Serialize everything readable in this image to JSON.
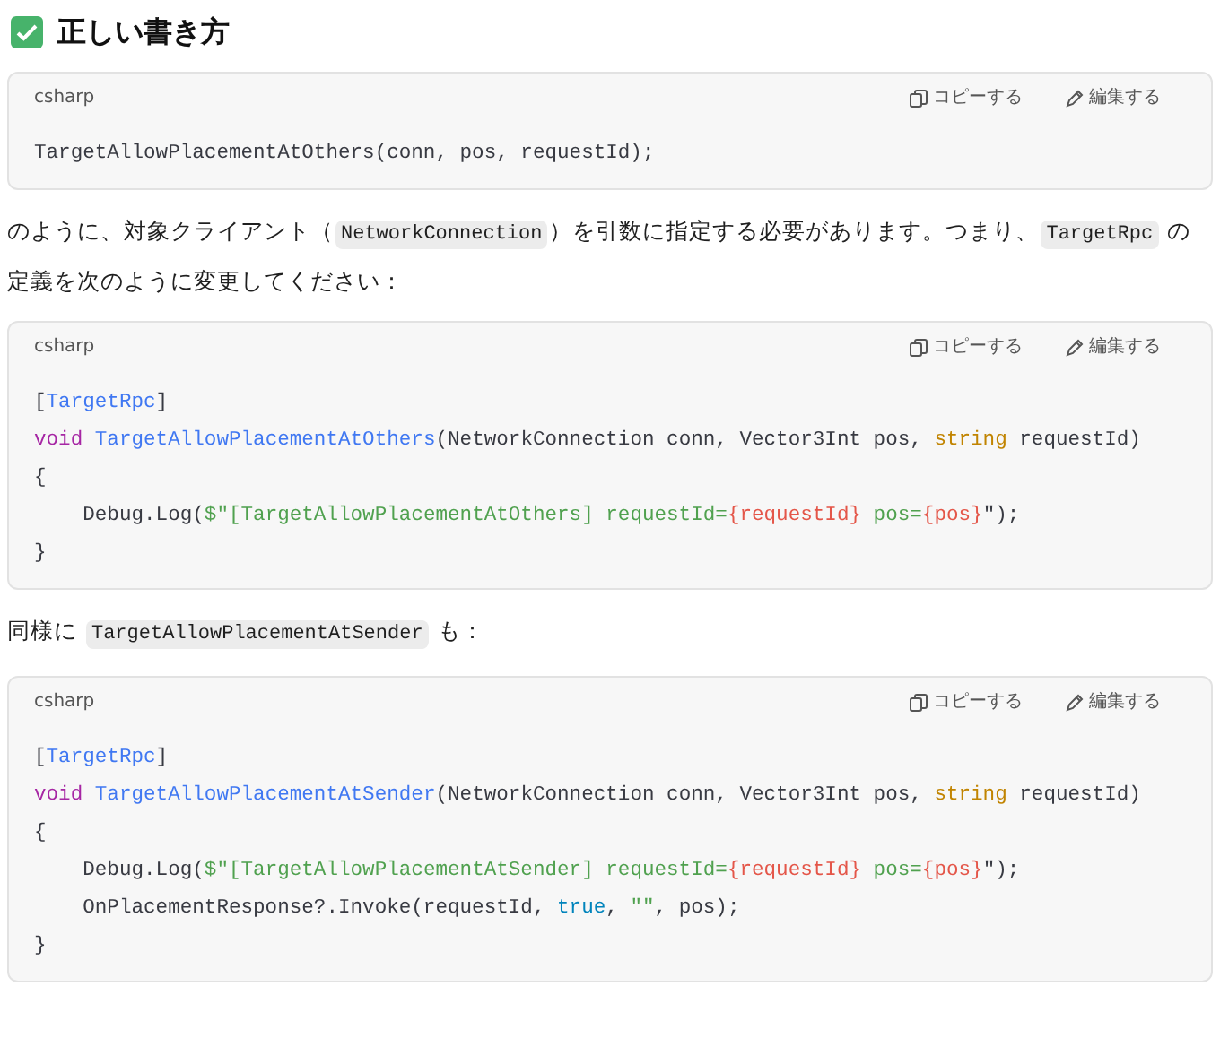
{
  "heading": {
    "text": "正しい書き方"
  },
  "content": [
    {
      "kind": "code",
      "language": "csharp",
      "copy_label": "コピーする",
      "edit_label": "編集する",
      "lines": [
        [
          {
            "text": "TargetAllowPlacementAtOthers(conn, pos, requestId);",
            "kind": "plain"
          }
        ]
      ]
    },
    {
      "kind": "paragraph",
      "segments": [
        {
          "text": "のように、対象クライアント（",
          "kind": "text"
        },
        {
          "text": "NetworkConnection",
          "kind": "code"
        },
        {
          "text": "）を引数に指定する必要があります。つまり、",
          "kind": "text"
        },
        {
          "text": "TargetRpc",
          "kind": "code"
        },
        {
          "text": " の定義を次のように変更してください：",
          "kind": "text"
        }
      ]
    },
    {
      "kind": "code",
      "language": "csharp",
      "copy_label": "コピーする",
      "edit_label": "編集する",
      "lines": [
        [
          {
            "text": "[",
            "kind": "plain"
          },
          {
            "text": "TargetRpc",
            "kind": "attr"
          },
          {
            "text": "]",
            "kind": "plain"
          }
        ],
        [
          {
            "text": "void",
            "kind": "keyword"
          },
          {
            "text": " TargetAllowPlacementAtOthers",
            "kind": "attr"
          },
          {
            "text": "(NetworkConnection conn, Vector3Int pos, ",
            "kind": "plain"
          },
          {
            "text": "string",
            "kind": "type"
          },
          {
            "text": " requestId)",
            "kind": "plain"
          }
        ],
        [
          {
            "text": "{",
            "kind": "plain"
          }
        ],
        [
          {
            "text": "    Debug.Log(",
            "kind": "plain"
          },
          {
            "text": "$\"[TargetAllowPlacementAtOthers] requestId=",
            "kind": "string"
          },
          {
            "text": "{requestId}",
            "kind": "interp"
          },
          {
            "text": " pos=",
            "kind": "string"
          },
          {
            "text": "{pos}",
            "kind": "interp"
          },
          {
            "text": "\");",
            "kind": "plain"
          }
        ],
        [
          {
            "text": "}",
            "kind": "plain"
          }
        ]
      ]
    },
    {
      "kind": "paragraph",
      "segments": [
        {
          "text": "同様に ",
          "kind": "text"
        },
        {
          "text": "TargetAllowPlacementAtSender",
          "kind": "code"
        },
        {
          "text": " も：",
          "kind": "text"
        }
      ]
    },
    {
      "kind": "code",
      "language": "csharp",
      "copy_label": "コピーする",
      "edit_label": "編集する",
      "lines": [
        [
          {
            "text": "[",
            "kind": "plain"
          },
          {
            "text": "TargetRpc",
            "kind": "attr"
          },
          {
            "text": "]",
            "kind": "plain"
          }
        ],
        [
          {
            "text": "void",
            "kind": "keyword"
          },
          {
            "text": " TargetAllowPlacementAtSender",
            "kind": "attr"
          },
          {
            "text": "(NetworkConnection conn, Vector3Int pos, ",
            "kind": "plain"
          },
          {
            "text": "string",
            "kind": "type"
          },
          {
            "text": " requestId)",
            "kind": "plain"
          }
        ],
        [
          {
            "text": "{",
            "kind": "plain"
          }
        ],
        [
          {
            "text": "    Debug.Log(",
            "kind": "plain"
          },
          {
            "text": "$\"[TargetAllowPlacementAtSender] requestId=",
            "kind": "string"
          },
          {
            "text": "{requestId}",
            "kind": "interp"
          },
          {
            "text": " pos=",
            "kind": "string"
          },
          {
            "text": "{pos}",
            "kind": "interp"
          },
          {
            "text": "\");",
            "kind": "plain"
          }
        ],
        [
          {
            "text": "    OnPlacementResponse?.Invoke(requestId, ",
            "kind": "plain"
          },
          {
            "text": "true",
            "kind": "literal"
          },
          {
            "text": ", ",
            "kind": "plain"
          },
          {
            "text": "\"\"",
            "kind": "string"
          },
          {
            "text": ", pos);",
            "kind": "plain"
          }
        ],
        [
          {
            "text": "}",
            "kind": "plain"
          }
        ]
      ]
    }
  ]
}
